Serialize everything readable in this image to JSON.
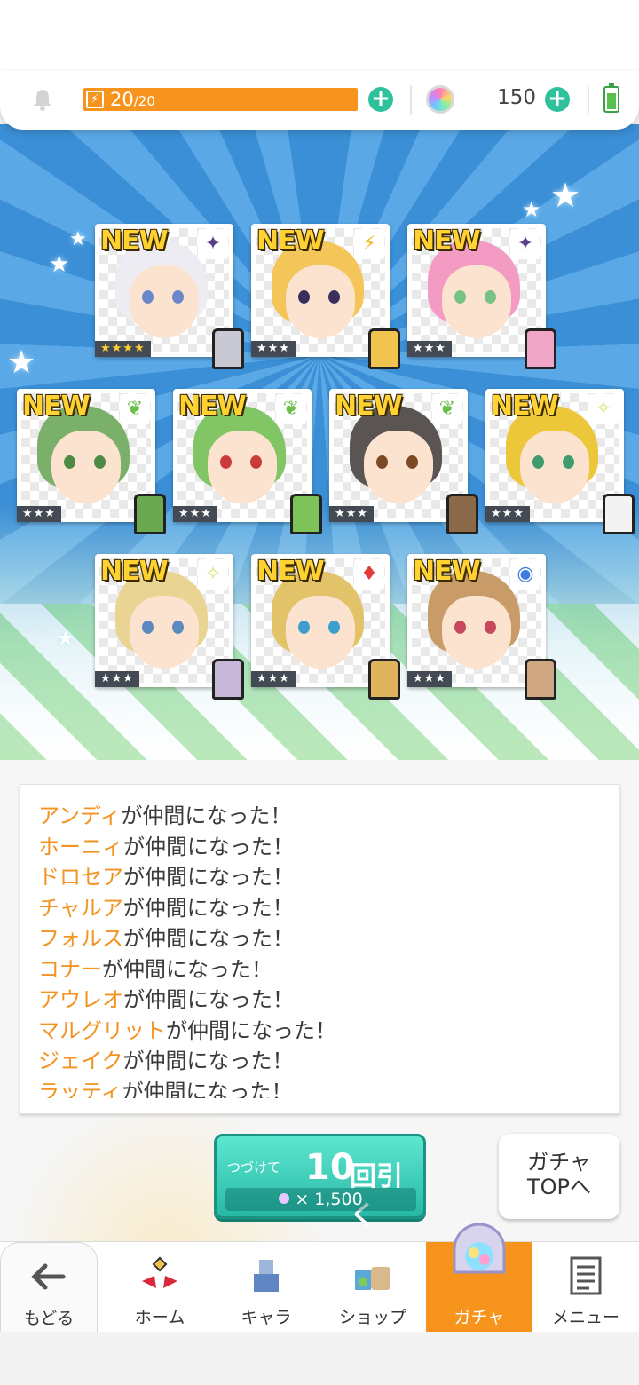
{
  "header": {
    "stamina_current": "20",
    "stamina_max": "/20",
    "stamina_icon": "lightning-bolt-icon",
    "gem_count": "150",
    "plus_label": "+"
  },
  "cards": [
    {
      "new": "NEW",
      "attr": "✦",
      "attr_color": "#5b3f8c",
      "rarity": "★★★★",
      "gold": true,
      "hair": "#ececf2",
      "eye": "#6b87c9",
      "sprite": "#c9c9d4"
    },
    {
      "new": "NEW",
      "attr": "⚡",
      "attr_color": "#f0b81a",
      "rarity": "★★★",
      "gold": false,
      "hair": "#f4c65a",
      "eye": "#3a2f5c",
      "sprite": "#f1c44f"
    },
    {
      "new": "NEW",
      "attr": "✦",
      "attr_color": "#5b3f8c",
      "rarity": "★★★",
      "gold": false,
      "hair": "#f39bc3",
      "eye": "#77c285",
      "sprite": "#f0a6c6"
    },
    {
      "new": "NEW",
      "attr": "❦",
      "attr_color": "#6bc04a",
      "rarity": "★★★",
      "gold": false,
      "hair": "#7bb06a",
      "eye": "#4d8a43",
      "sprite": "#6aa94f"
    },
    {
      "new": "NEW",
      "attr": "❦",
      "attr_color": "#6bc04a",
      "rarity": "★★★",
      "gold": false,
      "hair": "#82c565",
      "eye": "#cc3b3b",
      "sprite": "#7ec25a"
    },
    {
      "new": "NEW",
      "attr": "❦",
      "attr_color": "#6bc04a",
      "rarity": "★★★",
      "gold": false,
      "hair": "#5a5553",
      "eye": "#7b4a25",
      "sprite": "#8b6a4a"
    },
    {
      "new": "NEW",
      "attr": "✧",
      "attr_color": "#d3e86a",
      "rarity": "★★★",
      "gold": false,
      "hair": "#ecc73a",
      "eye": "#3f9c6c",
      "sprite": "#f3f3f3"
    },
    {
      "new": "NEW",
      "attr": "✧",
      "attr_color": "#d3e86a",
      "rarity": "★★★",
      "gold": false,
      "hair": "#ead494",
      "eye": "#5c89bf",
      "sprite": "#c7b7d8"
    },
    {
      "new": "NEW",
      "attr": "♦",
      "attr_color": "#e23b3b",
      "rarity": "★★★",
      "gold": false,
      "hair": "#e3c36a",
      "eye": "#3c9fcf",
      "sprite": "#e0b45c"
    },
    {
      "new": "NEW",
      "attr": "◉",
      "attr_color": "#3d7ee0",
      "rarity": "★★★",
      "gold": false,
      "hair": "#c89b69",
      "eye": "#c8485d",
      "sprite": "#cfa883"
    }
  ],
  "log": [
    {
      "name": "アンディ",
      "text": "が仲間になった！"
    },
    {
      "name": "ホーニィ",
      "text": "が仲間になった！"
    },
    {
      "name": "ドロセア",
      "text": "が仲間になった！"
    },
    {
      "name": "チャルア",
      "text": "が仲間になった！"
    },
    {
      "name": "フォルス",
      "text": "が仲間になった！"
    },
    {
      "name": "コナー",
      "text": "が仲間になった！"
    },
    {
      "name": "アウレオ",
      "text": "が仲間になった！"
    },
    {
      "name": "マルグリット",
      "text": "が仲間になった！"
    },
    {
      "name": "ジェイク",
      "text": "が仲間になった！"
    },
    {
      "name": "ラッティ",
      "text": "が仲間になった！"
    }
  ],
  "actions": {
    "ten_pre": "つづけて",
    "ten_num": "10",
    "ten_main": "回引く",
    "ten_cost": "× 1,500",
    "top_line1": "ガチャ",
    "top_line2": "TOPへ"
  },
  "nav": {
    "back": "もどる",
    "home": "ホーム",
    "chara": "キャラ",
    "shop": "ショップ",
    "gacha": "ガチャ",
    "menu": "メニュー"
  },
  "colors": {
    "accent_orange": "#f7941d",
    "teal": "#2fc19c",
    "name_orange": "#f39322"
  }
}
